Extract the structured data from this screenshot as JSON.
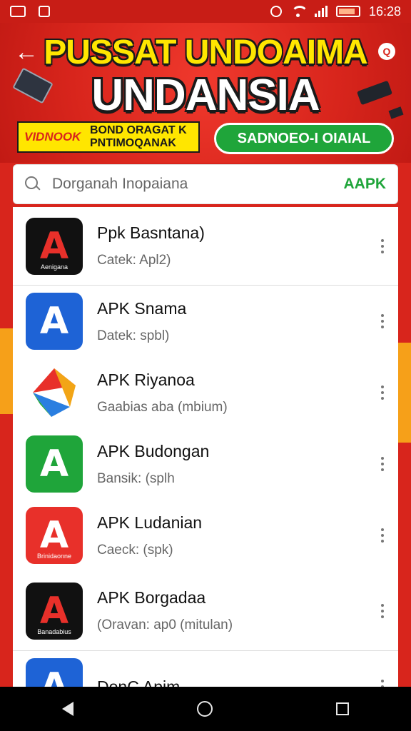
{
  "status_bar": {
    "time": "16:28",
    "icons": [
      "notification-icon",
      "photo-icon",
      "alarm-icon",
      "wifi-icon",
      "signal-icon",
      "battery-icon"
    ]
  },
  "banner": {
    "title_line1": "PUSSAT UNDOAIMA",
    "title_line2": "UNDANSIA",
    "promo_red": "VIDNOOK",
    "promo_line1": "BOND ORAGAT K",
    "promo_line2": "PNTIMOQANAK",
    "green_button": "SADNOEO-I OIAIAL"
  },
  "search": {
    "placeholder": "Dorganah Inopaiana",
    "badge": "AAPK"
  },
  "apps": [
    {
      "name": "Ppk Basntana)",
      "subtitle": "Catek: Apl2)",
      "icon_label": "Aenigana",
      "icon_glyph": "A",
      "icon_bg": "#111111",
      "icon_color": "#e8302a"
    },
    {
      "name": "APK Snama",
      "subtitle": "Datek: spbl)",
      "icon_label": "",
      "icon_glyph": "A",
      "icon_bg": "#1e63d6",
      "icon_color": "#ffffff"
    },
    {
      "name": "APK Riyanoa",
      "subtitle": "Gaabias aba (mbium)",
      "icon_label": "",
      "icon_glyph": "▶",
      "icon_bg": "#ffffff",
      "icon_color": "#f2a516"
    },
    {
      "name": "APK Budongan",
      "subtitle": "Bansik: (splh",
      "icon_label": "",
      "icon_glyph": "A",
      "icon_bg": "#1fa53a",
      "icon_color": "#ffffff"
    },
    {
      "name": "APK Ludanian",
      "subtitle": "Caeck: (spk)",
      "icon_label": "Brinidaonne",
      "icon_glyph": "A",
      "icon_bg": "#e8302a",
      "icon_color": "#ffffff"
    },
    {
      "name": "APK Borgadaa",
      "subtitle": "(Oravan: ap0 (mitulan)",
      "icon_label": "Banadabius",
      "icon_glyph": "A",
      "icon_bg": "#111111",
      "icon_color": "#e8302a"
    },
    {
      "name": "DonC Apim",
      "subtitle": "",
      "icon_label": "",
      "icon_glyph": "A",
      "icon_bg": "#1e63d6",
      "icon_color": "#ffffff"
    }
  ],
  "colors": {
    "brand_red": "#d8251c",
    "accent_yellow": "#ffe600",
    "accent_green": "#1fa53a"
  }
}
